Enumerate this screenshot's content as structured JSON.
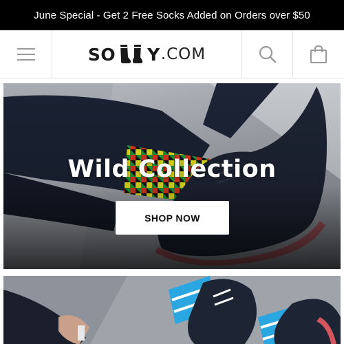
{
  "promo_banner": {
    "text": "June Special - Get 2 Free Socks Added on Orders over $50"
  },
  "header": {
    "logo": {
      "prefix": "SO",
      "suffix": "Y",
      "tld": ".COM"
    },
    "menu_icon": "hamburger-menu-icon",
    "search_icon": "search-icon",
    "cart_icon": "shopping-bag-icon"
  },
  "hero": {
    "title": "Wild Collection",
    "cta_label": "SHOP NOW"
  },
  "colors": {
    "banner_bg": "#000000",
    "banner_text": "#ffffff",
    "icon_gray": "#9a9a9a",
    "button_bg": "#ffffff",
    "button_text": "#111111"
  }
}
